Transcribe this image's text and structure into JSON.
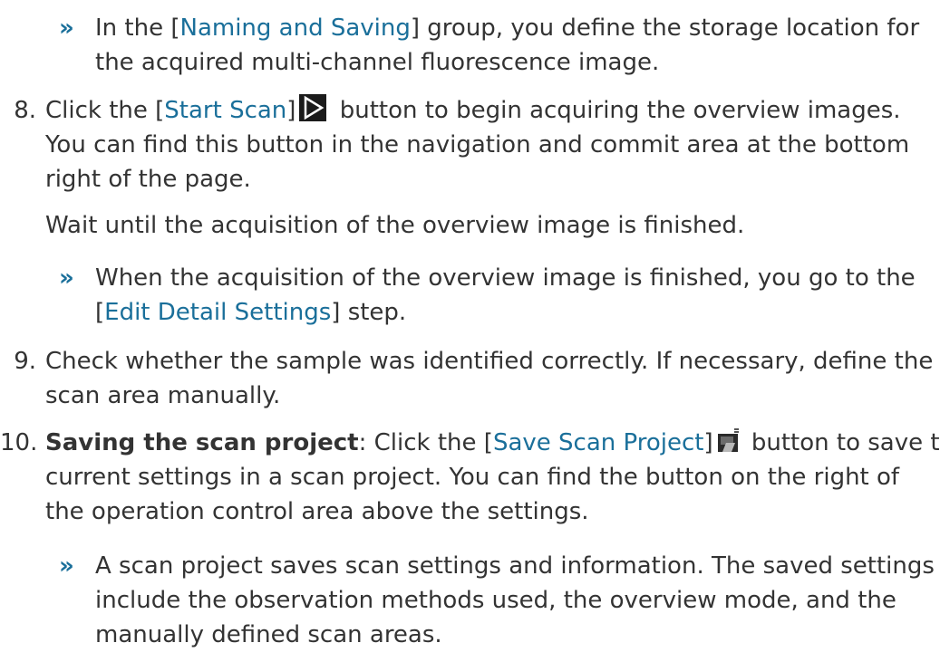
{
  "intro": {
    "line1_a": "In the [",
    "line1_link": "Naming and Saving",
    "line1_b": "] group, you define the storage location for",
    "line2": "the acquired multi-channel fluorescence image."
  },
  "step8": {
    "number": "8.",
    "a": "Click the [",
    "link": "Start Scan",
    "b": "]",
    "c": "button to begin acquiring the overview images.",
    "line2": "You can find this button in the navigation and commit area at the bottom",
    "line3": "right of the page.",
    "wait": "Wait until the acquisition of the overview image is finished.",
    "result_line1": "When the acquisition of the overview image is finished, you go to the",
    "result_a": "[",
    "result_link": "Edit Detail Settings",
    "result_b": "] step."
  },
  "step9": {
    "number": "9.",
    "line1": "Check whether the sample was identified correctly. If necessary, define the",
    "line2": "scan area manually."
  },
  "step10": {
    "number": "10.",
    "bold": "Saving the scan project",
    "a": ": Click the [",
    "link": "Save Scan Project",
    "b": "]",
    "c": "button to save the",
    "line2": "current settings in a scan project. You can find the button on the right of",
    "line3": "the operation control area above the settings.",
    "result_line1": "A scan project saves scan settings and information. The saved settings",
    "result_line2": "include the observation methods used, the overview mode, and the",
    "result_line3": "manually defined scan areas."
  },
  "icons": {
    "chevron": "»",
    "start_scan_icon": "play-triangle-icon",
    "save_scan_icon": "save-project-icon"
  },
  "colors": {
    "text": "#333333",
    "link": "#1a6f9a"
  }
}
